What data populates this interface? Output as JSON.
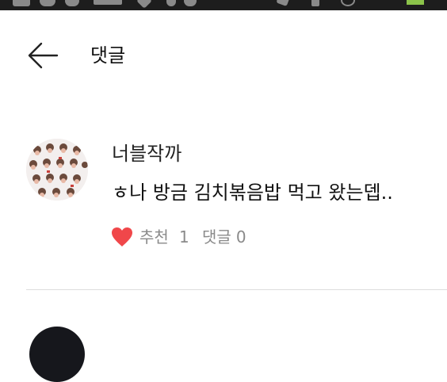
{
  "header": {
    "title": "댓글",
    "back_icon": "arrow-left-icon"
  },
  "comment": {
    "author": "너블작까",
    "text": "ㅎ나 방금 김치볶음밥 먹고 왔는뎁..",
    "like_label": "추천",
    "like_count": "1",
    "reply_label": "댓글",
    "reply_count": "0",
    "like_icon": "heart-icon",
    "like_color": "#f0474a"
  },
  "colors": {
    "status_bar": "#1d1d1d",
    "battery": "#8bc34a",
    "meta_text": "#8a8a8a",
    "divider": "#dddddd"
  }
}
